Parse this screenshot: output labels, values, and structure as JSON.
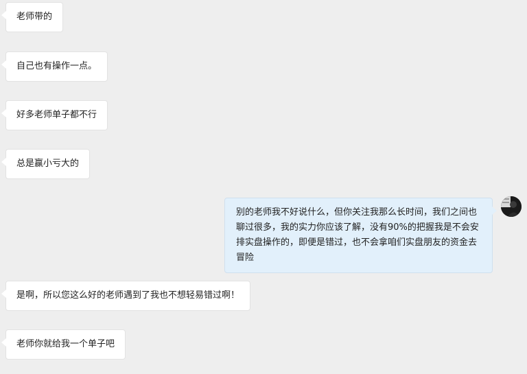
{
  "chat": {
    "messages": [
      {
        "direction": "in",
        "text": "老师带的"
      },
      {
        "direction": "in",
        "text": "自己也有操作一点。"
      },
      {
        "direction": "in",
        "text": "好多老师单子都不行"
      },
      {
        "direction": "in",
        "text": "总是赢小亏大的"
      },
      {
        "direction": "out",
        "text": "别的老师我不好说什么，但你关注我那么长时间，我们之间也聊过很多，我的实力你应该了解，没有90%的把握我是不会安排实盘操作的，即便是错过，也不会拿咱们实盘朋友的资金去冒险"
      },
      {
        "direction": "in",
        "text": "是啊，所以您这么好的老师遇到了我也不想轻易错过啊！"
      },
      {
        "direction": "in",
        "text": "老师你就给我一个单子吧"
      }
    ]
  },
  "colors": {
    "background": "#eeeeee",
    "incoming_bubble": "#ffffff",
    "outgoing_bubble": "#e2f0fb",
    "text": "#222222"
  }
}
